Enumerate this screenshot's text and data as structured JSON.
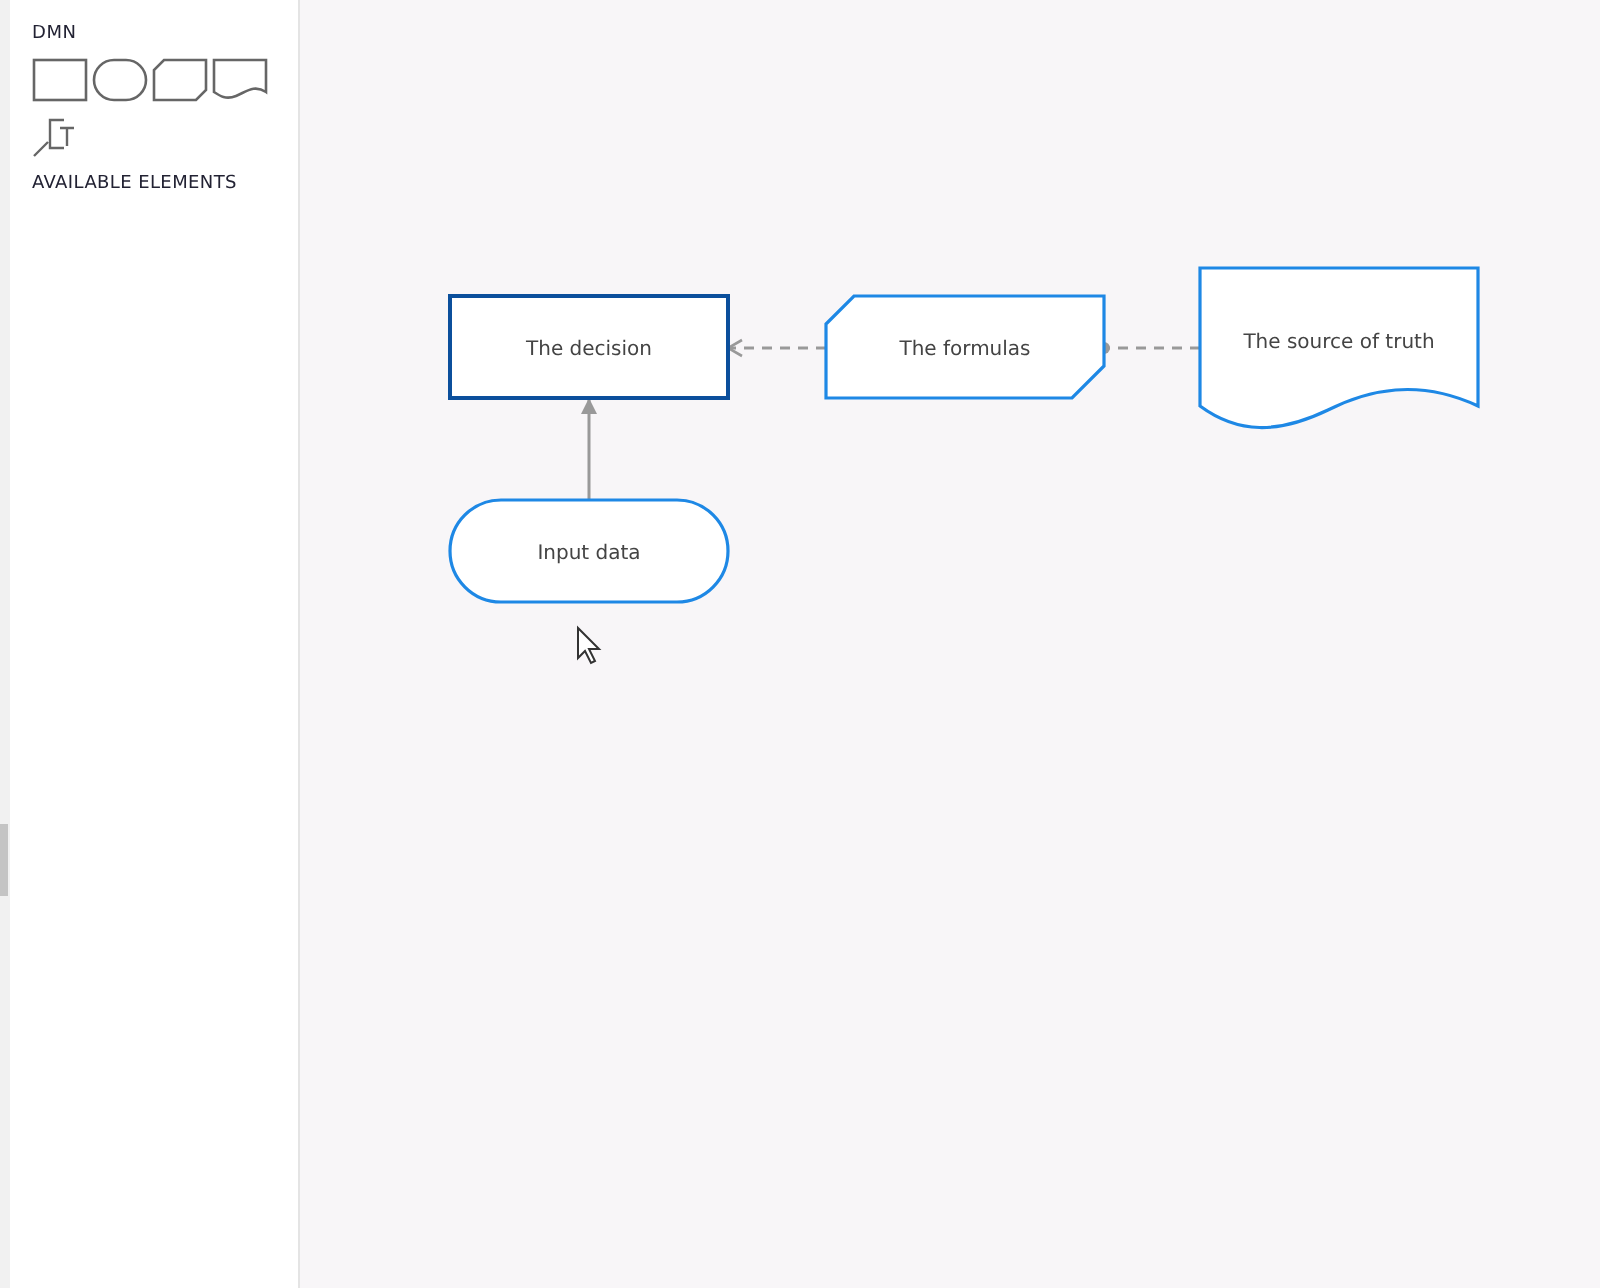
{
  "palette": {
    "title": "DMN",
    "tools": [
      {
        "kind": "decision"
      },
      {
        "kind": "input"
      },
      {
        "kind": "bkm"
      },
      {
        "kind": "source"
      },
      {
        "kind": "annotation"
      }
    ],
    "section": "AVAILABLE ELEMENTS"
  },
  "diagram": {
    "nodes": [
      {
        "kind": "decision",
        "label": "The decision",
        "selected": true
      },
      {
        "kind": "bkm",
        "label": "The formulas",
        "selected": false
      },
      {
        "kind": "source",
        "label": "The source of truth",
        "selected": false
      },
      {
        "kind": "input",
        "label": "Input data",
        "selected": false
      }
    ],
    "edges": [
      {
        "kind": "information"
      },
      {
        "kind": "knowledge"
      },
      {
        "kind": "authority"
      }
    ]
  }
}
